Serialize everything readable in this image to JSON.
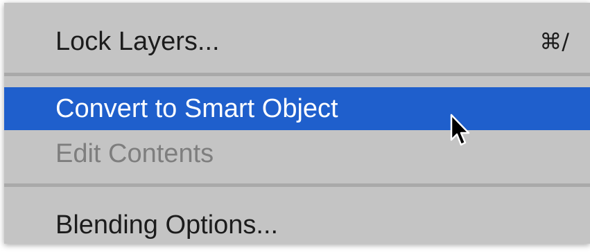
{
  "menu": {
    "items": [
      {
        "label": "Lock Layers...",
        "shortcut": "⌘/",
        "state": "normal"
      },
      {
        "label": "Convert to Smart Object",
        "state": "highlighted"
      },
      {
        "label": "Edit Contents",
        "state": "disabled"
      },
      {
        "label": "Blending Options...",
        "state": "normal"
      }
    ]
  },
  "cursor": {
    "icon": "arrow-pointer-icon"
  },
  "colors": {
    "menu_background": "#c4c4c4",
    "highlight": "#1f5fcc",
    "disabled_text": "#7e7e7e",
    "separator": "#a9a9a9"
  }
}
